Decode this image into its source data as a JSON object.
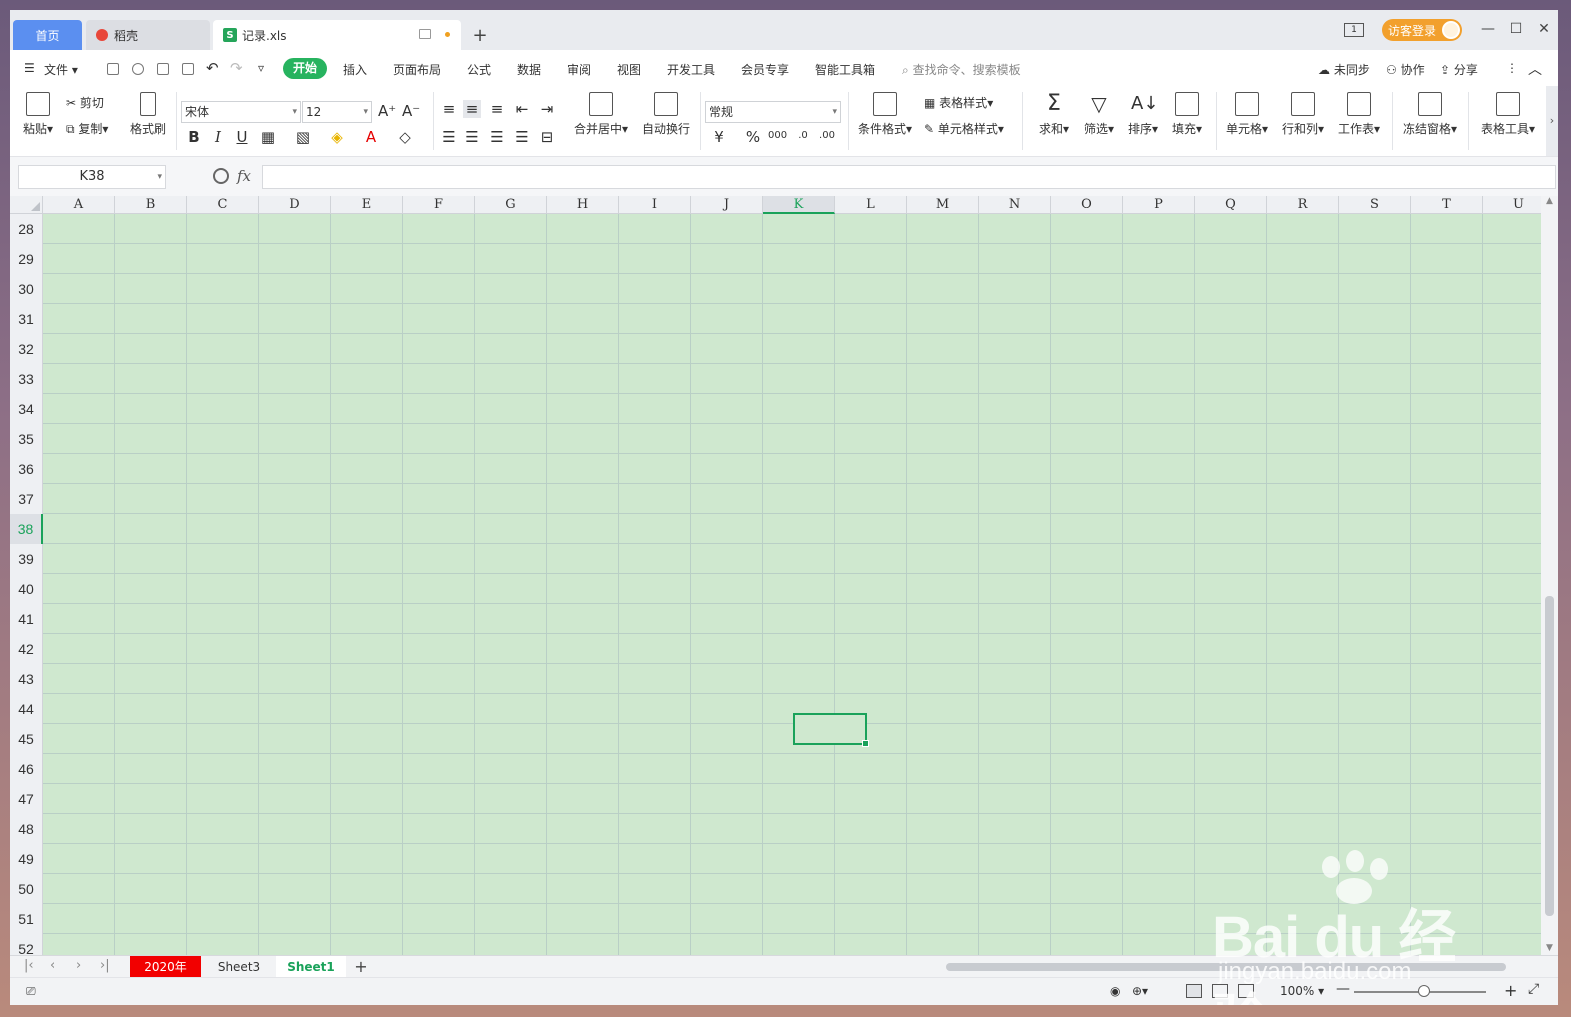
{
  "titlebar": {
    "home_tab": "首页",
    "daoke_tab": "稻壳",
    "file_tab": "记录.xls",
    "file_icon": "S",
    "read_mode": "1",
    "login": "访客登录"
  },
  "menu": {
    "file": "文件",
    "items": [
      "开始",
      "插入",
      "页面布局",
      "公式",
      "数据",
      "审阅",
      "视图",
      "开发工具",
      "会员专享",
      "智能工具箱"
    ],
    "search_placeholder": "查找命令、搜索模板",
    "sync": "未同步",
    "collab": "协作",
    "share": "分享"
  },
  "ribbon": {
    "paste": "粘贴",
    "cut": "剪切",
    "copy": "复制",
    "format_painter": "格式刷",
    "font": "宋体",
    "font_size": "12",
    "merge_center": "合并居中",
    "wrap": "自动换行",
    "number_format": "常规",
    "cond_format": "条件格式",
    "table_style": "表格样式",
    "cell_style": "单元格样式",
    "sum": "求和",
    "filter": "筛选",
    "sort": "排序",
    "fill": "填充",
    "cell": "单元格",
    "row_col": "行和列",
    "worksheet": "工作表",
    "freeze": "冻结窗格",
    "table_tools": "表格工具"
  },
  "formula_bar": {
    "name_box": "K38",
    "fx": "fx",
    "value": ""
  },
  "grid": {
    "columns": [
      "A",
      "B",
      "C",
      "D",
      "E",
      "F",
      "G",
      "H",
      "I",
      "J",
      "K",
      "L",
      "M",
      "N",
      "O",
      "P",
      "Q",
      "R",
      "S",
      "T",
      "U"
    ],
    "rows": [
      "28",
      "29",
      "30",
      "31",
      "32",
      "33",
      "34",
      "35",
      "36",
      "37",
      "38",
      "39",
      "40",
      "41",
      "42",
      "43",
      "44",
      "45",
      "46",
      "47",
      "48",
      "49",
      "50",
      "51",
      "52"
    ],
    "active_column": "K",
    "active_row": "38",
    "cell_fill": "#cfe8cf",
    "accent": "#1aa25a"
  },
  "sheets": {
    "tabs": [
      "2020年",
      "Sheet3",
      "Sheet1"
    ],
    "active": "Sheet1",
    "red_tab_color": "#f20000"
  },
  "status": {
    "zoom": "100%"
  },
  "watermark": {
    "brand": "Bai du 经验",
    "url": "jingyan.baidu.com"
  }
}
